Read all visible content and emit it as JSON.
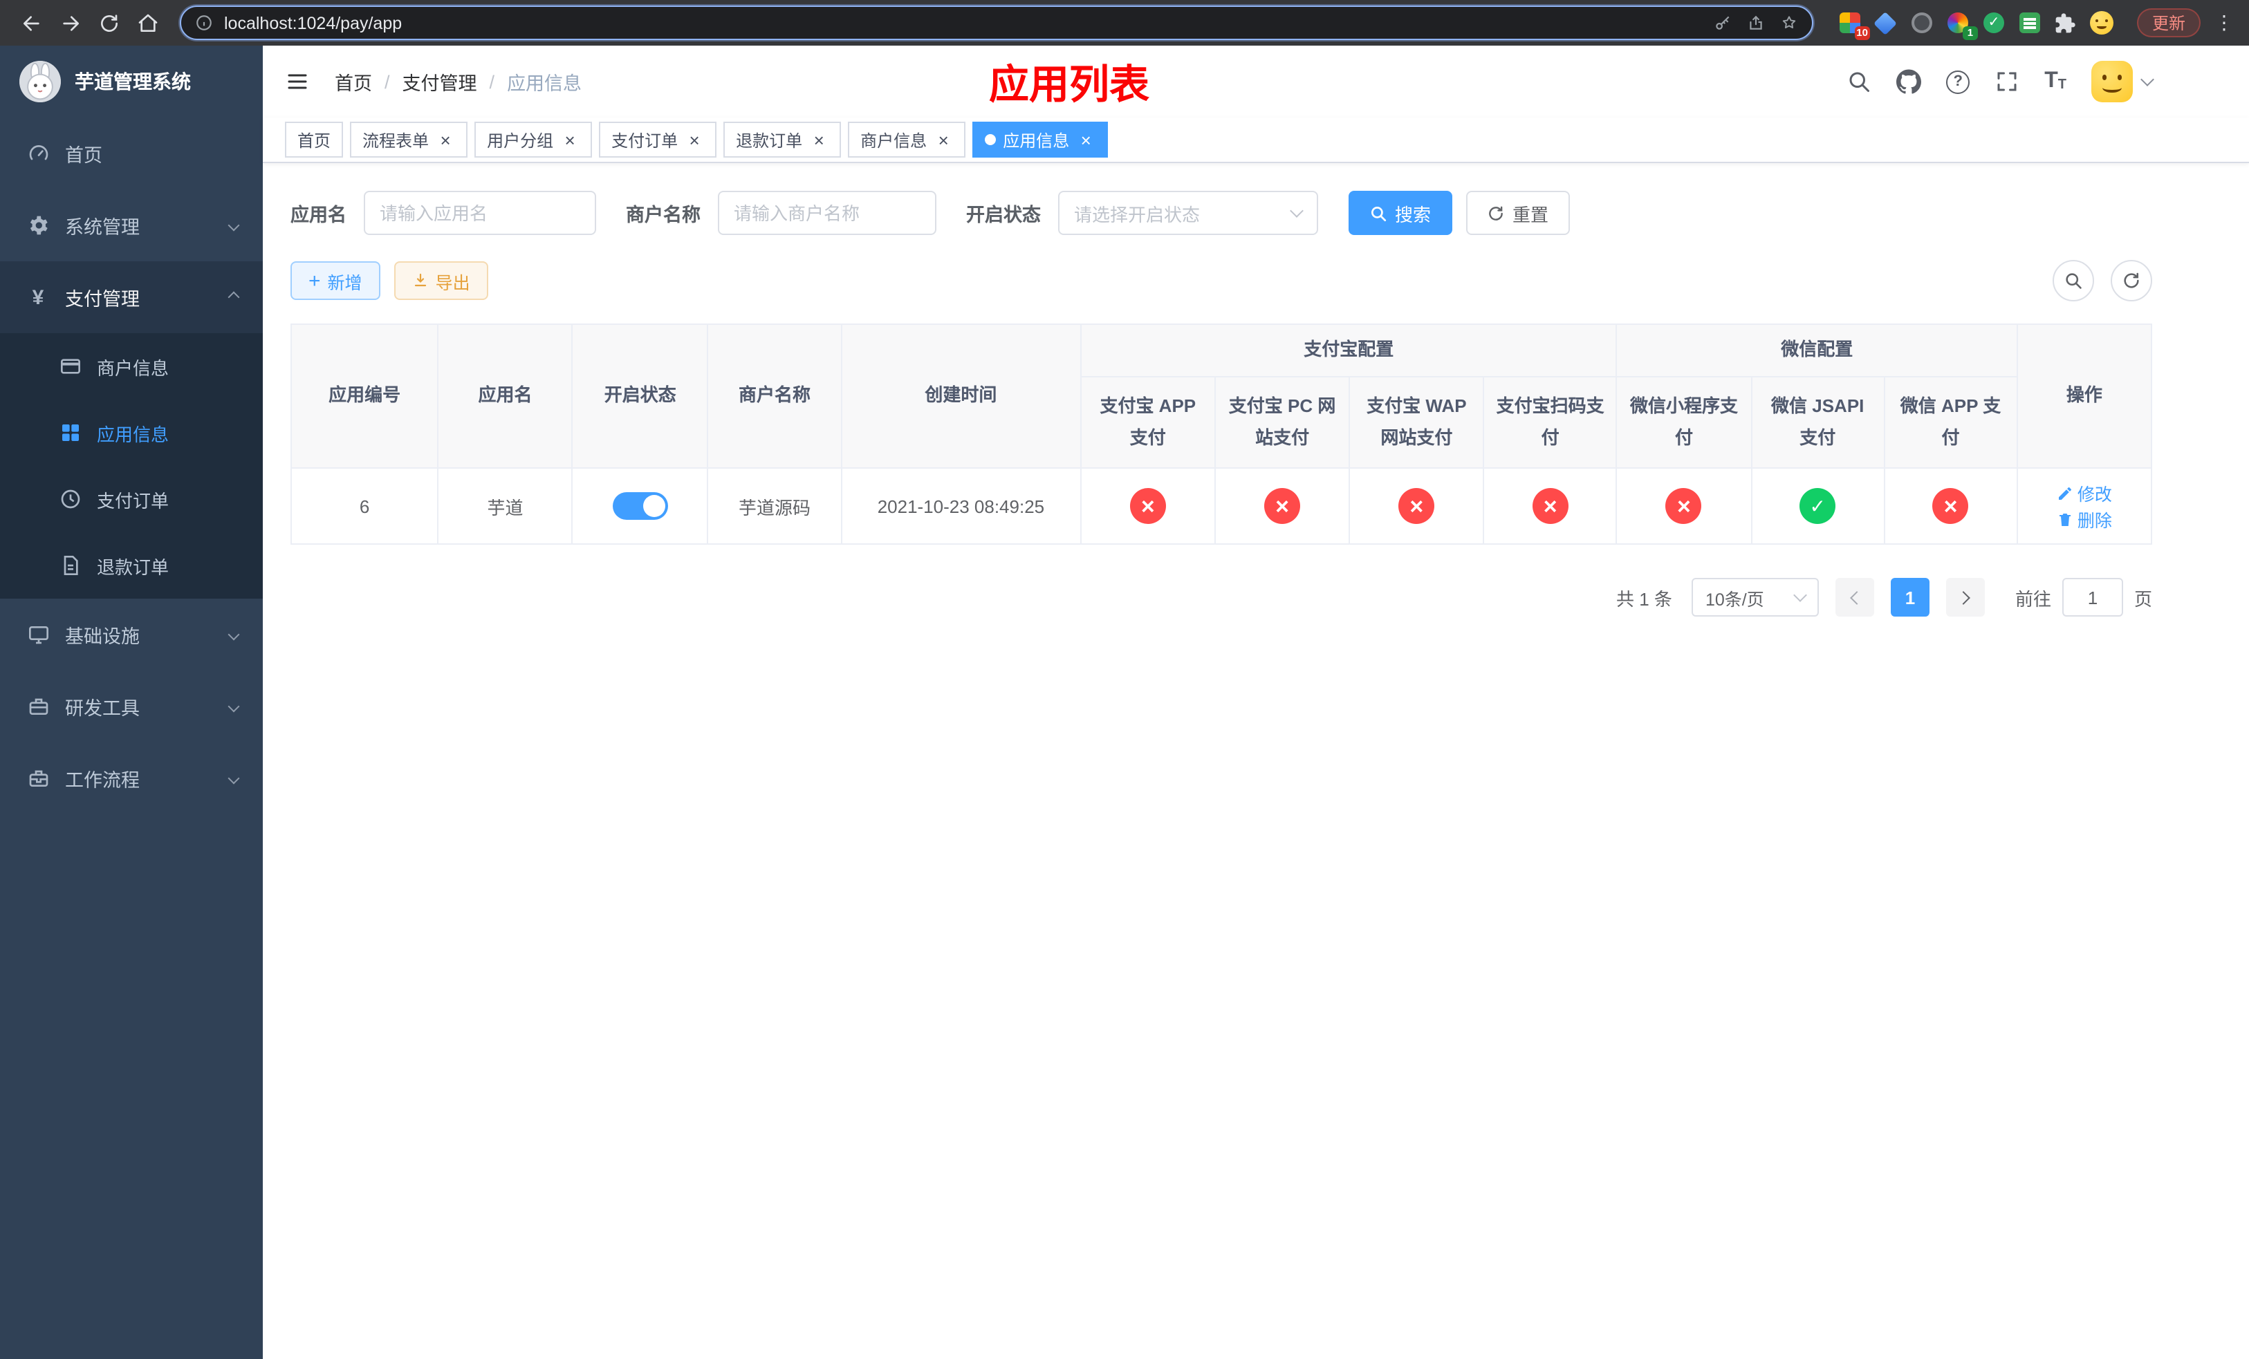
{
  "browser": {
    "url": "localhost:1024/pay/app",
    "update_label": "更新",
    "ext_badge_grid": "10",
    "ext_badge_circle": "1"
  },
  "sidebar": {
    "title": "芋道管理系统",
    "items": [
      {
        "label": "首页"
      },
      {
        "label": "系统管理"
      },
      {
        "label": "支付管理",
        "children": [
          {
            "label": "商户信息"
          },
          {
            "label": "应用信息"
          },
          {
            "label": "支付订单"
          },
          {
            "label": "退款订单"
          }
        ]
      },
      {
        "label": "基础设施"
      },
      {
        "label": "研发工具"
      },
      {
        "label": "工作流程"
      }
    ]
  },
  "header": {
    "breadcrumb": [
      "首页",
      "支付管理",
      "应用信息"
    ],
    "annotation_title": "应用列表"
  },
  "tabs": [
    {
      "label": "首页"
    },
    {
      "label": "流程表单"
    },
    {
      "label": "用户分组"
    },
    {
      "label": "支付订单"
    },
    {
      "label": "退款订单"
    },
    {
      "label": "商户信息"
    },
    {
      "label": "应用信息"
    }
  ],
  "filters": {
    "app_name_label": "应用名",
    "app_name_placeholder": "请输入应用名",
    "merchant_label": "商户名称",
    "merchant_placeholder": "请输入商户名称",
    "status_label": "开启状态",
    "status_placeholder": "请选择开启状态",
    "search_label": "搜索",
    "reset_label": "重置"
  },
  "toolbar": {
    "add_label": "新增",
    "export_label": "导出"
  },
  "table": {
    "groups": {
      "alipay": "支付宝配置",
      "wechat": "微信配置"
    },
    "columns": [
      "应用编号",
      "应用名",
      "开启状态",
      "商户名称",
      "创建时间",
      "支付宝 APP 支付",
      "支付宝 PC 网站支付",
      "支付宝 WAP 网站支付",
      "支付宝扫码支付",
      "微信小程序支付",
      "微信 JSAPI 支付",
      "微信 APP 支付",
      "操作"
    ],
    "rows": [
      {
        "id": "6",
        "name": "芋道",
        "enabled": true,
        "merchant": "芋道源码",
        "created": "2021-10-23 08:49:25",
        "alipay_app": false,
        "alipay_pc": false,
        "alipay_wap": false,
        "alipay_scan": false,
        "wechat_mini": false,
        "wechat_jsapi": true,
        "wechat_app": false,
        "edit_label": "修改",
        "delete_label": "删除"
      }
    ]
  },
  "pagination": {
    "total": "共 1 条",
    "page_size": "10条/页",
    "page": "1",
    "goto_label": "前往",
    "goto_value": "1",
    "unit_label": "页"
  },
  "icons": {
    "status_yes": "✓",
    "status_no": "×",
    "tab_close": "×"
  },
  "colors": {
    "primary": "#409eff",
    "success": "#12ce66",
    "danger": "#ff4a4a",
    "warning": "#e6a23c",
    "sidebar_bg": "#304156",
    "submenu_bg": "#1f2d3d",
    "annotation": "#fb0505"
  }
}
